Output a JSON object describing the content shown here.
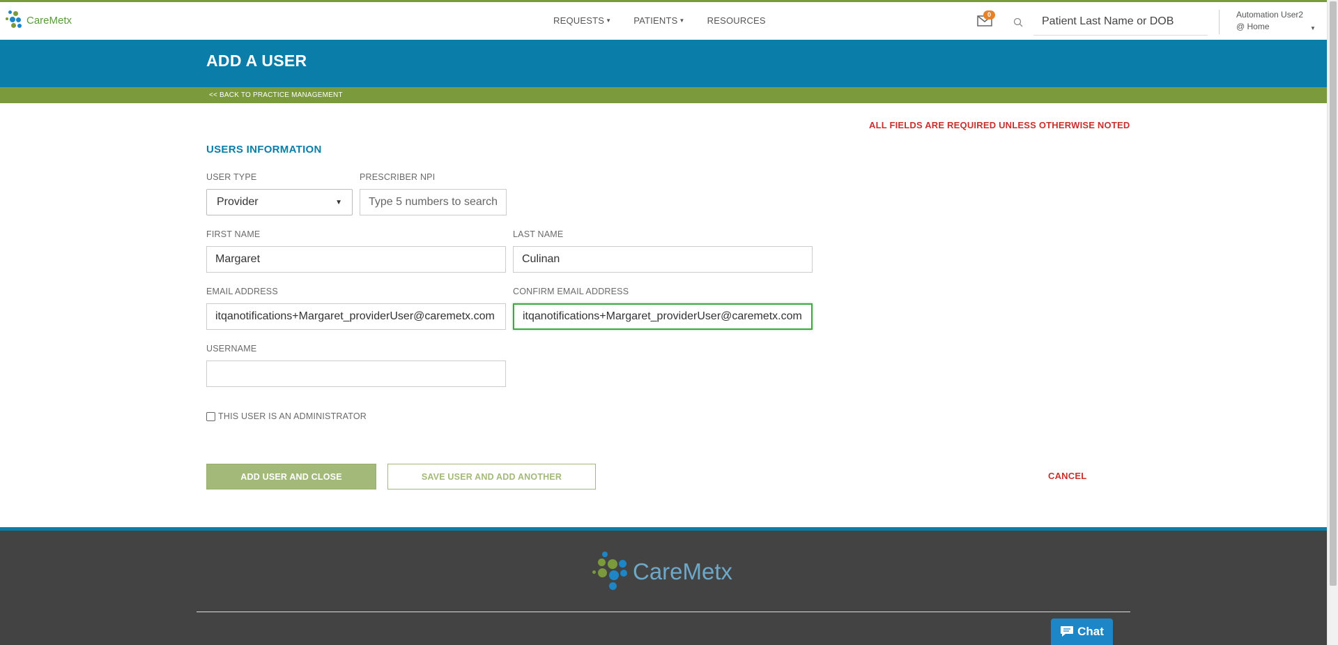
{
  "brand": {
    "name": "CareMetx",
    "colors": {
      "primary_blue": "#0a7da8",
      "accent_green": "#7b9a3b",
      "alert_red": "#c9302c"
    }
  },
  "nav": {
    "items": [
      {
        "label": "REQUESTS",
        "has_dropdown": true
      },
      {
        "label": "PATIENTS",
        "has_dropdown": true
      },
      {
        "label": "RESOURCES",
        "has_dropdown": false
      }
    ],
    "mail_badge": "0",
    "search_placeholder": "Patient Last Name or DOB",
    "user_name": "Automation User2",
    "user_location": "@ Home"
  },
  "page": {
    "title": "ADD A USER",
    "back_link": "<< BACK TO PRACTICE MANAGEMENT",
    "required_note": "ALL FIELDS ARE REQUIRED UNLESS OTHERWISE NOTED",
    "section_title": "USERS INFORMATION"
  },
  "form": {
    "user_type": {
      "label": "USER TYPE",
      "value": "Provider"
    },
    "prescriber_npi": {
      "label": "PRESCRIBER NPI",
      "value": "",
      "placeholder": "Type 5 numbers to search"
    },
    "first_name": {
      "label": "FIRST NAME",
      "value": "Margaret"
    },
    "last_name": {
      "label": "LAST NAME",
      "value": "Culinan"
    },
    "email": {
      "label": "EMAIL ADDRESS",
      "value": "itqanotifications+Margaret_providerUser@caremetx.com"
    },
    "confirm_email": {
      "label": "CONFIRM EMAIL ADDRESS",
      "value": "itqanotifications+Margaret_providerUser@caremetx.com"
    },
    "username": {
      "label": "USERNAME",
      "value": ""
    },
    "admin": {
      "label": "THIS USER IS AN ADMINISTRATOR",
      "checked": false
    }
  },
  "actions": {
    "add_close": "ADD USER AND CLOSE",
    "save_another": "SAVE USER AND ADD ANOTHER",
    "cancel": "CANCEL"
  },
  "footer": {
    "logo_text": "CareMetx"
  },
  "chat": {
    "label": "Chat"
  }
}
